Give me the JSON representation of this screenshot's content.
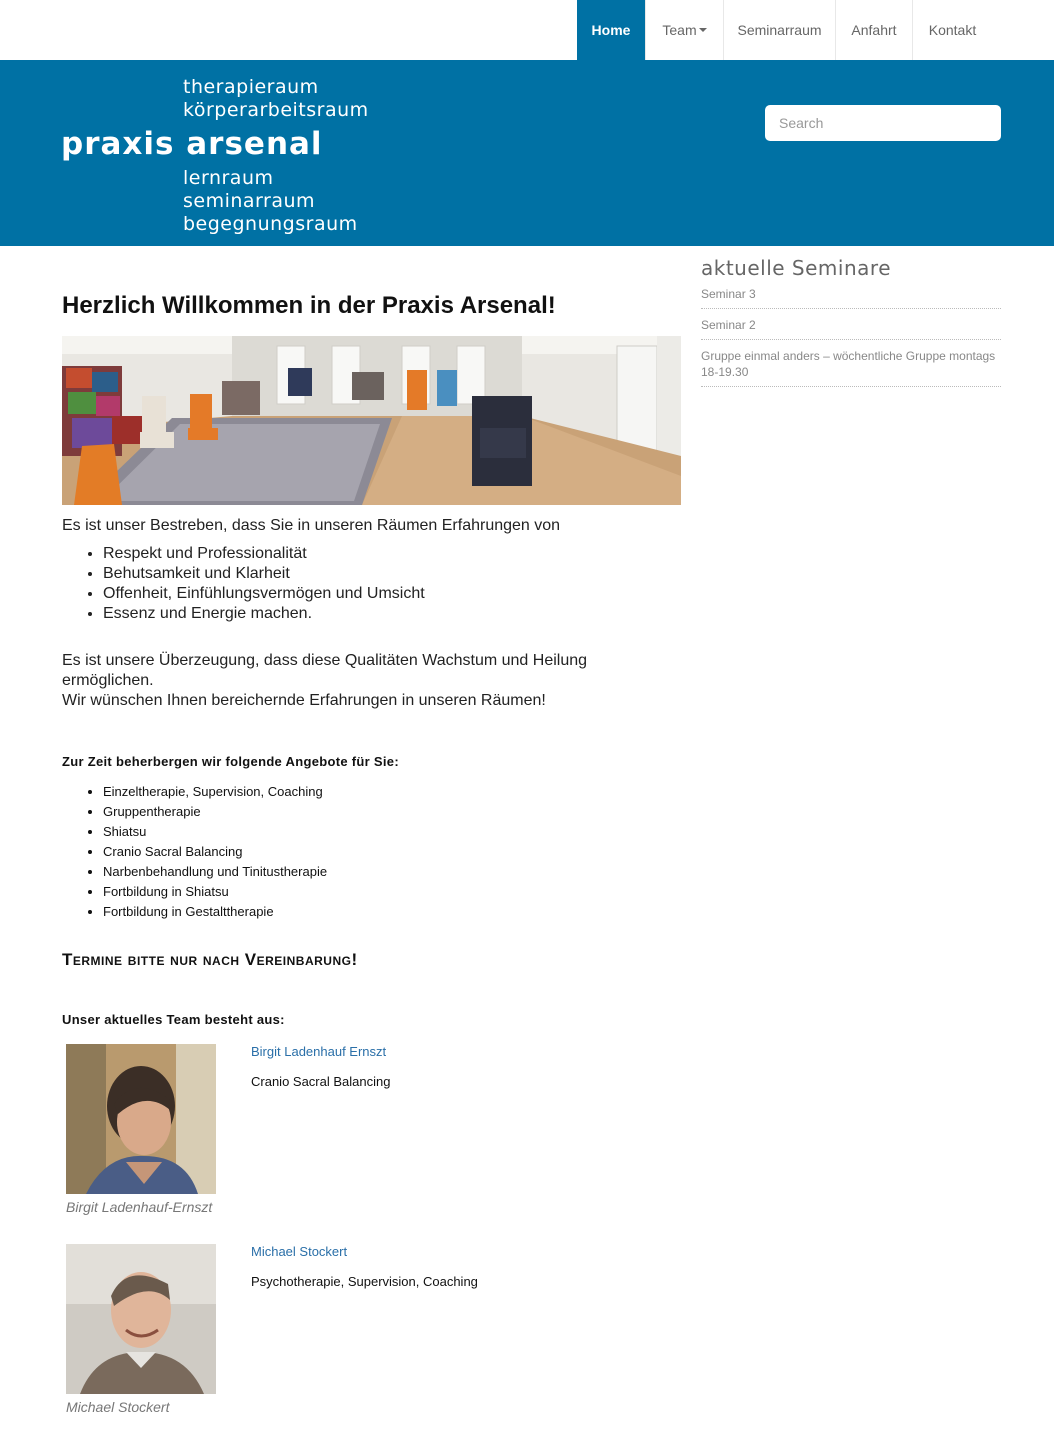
{
  "nav": {
    "items": [
      {
        "label": "Home",
        "active": true
      },
      {
        "label": "Team",
        "active": false,
        "dropdown": true
      },
      {
        "label": "Seminarraum",
        "active": false
      },
      {
        "label": "Anfahrt",
        "active": false
      },
      {
        "label": "Kontakt",
        "active": false
      }
    ]
  },
  "header": {
    "logo_lines_top": [
      "therapieraum",
      "körperarbeitsraum"
    ],
    "logo_main": "praxis arsenal",
    "logo_lines_bottom": [
      "lernraum",
      "seminarraum",
      "begegnungsraum"
    ],
    "search_placeholder": "Search"
  },
  "main": {
    "title": "Herzlich Willkommen in der Praxis Arsenal!",
    "intro": "Es ist unser Bestreben, dass Sie in unseren Räumen Erfahrungen von",
    "qualities": [
      "Respekt und Professionalität",
      "Behutsamkeit und Klarheit",
      "Offenheit, Einfühlungsvermögen und Umsicht",
      "Essenz und Energie machen."
    ],
    "para_1": "Es ist unsere Überzeugung, dass diese Qualitäten Wachstum und Heilung ermöglichen.",
    "para_2": "Wir wünschen Ihnen bereichernde Erfahrungen in unseren Räumen!",
    "offers_heading": "Zur Zeit beherbergen wir folgende Angebote für Sie:",
    "offers": [
      "Einzeltherapie, Supervision, Coaching",
      "Gruppentherapie",
      "Shiatsu",
      "Cranio Sacral Balancing",
      "Narbenbehandlung und Tinitustherapie",
      "Fortbildung in Shiatsu",
      "Fortbildung in Gestalttherapie"
    ],
    "termine": "Termine bitte nur nach Vereinbarung!",
    "team_heading": "Unser aktuelles Team besteht aus:",
    "team": [
      {
        "name": "Birgit Ladenhauf Ernszt",
        "role": "Cranio Sacral Balancing",
        "caption": "Birgit Ladenhauf-Ernszt"
      },
      {
        "name": "Michael Stockert",
        "role": "Psychotherapie, Supervision, Coaching",
        "caption": "Michael Stockert"
      }
    ]
  },
  "sidebar": {
    "title": "aktuelle Seminare",
    "items": [
      "Seminar 3",
      "Seminar 2",
      "Gruppe einmal anders – wöchentliche Gruppe montags 18-19.30"
    ]
  },
  "colors": {
    "brand": "#0071a4",
    "link": "#2a6fa8"
  }
}
